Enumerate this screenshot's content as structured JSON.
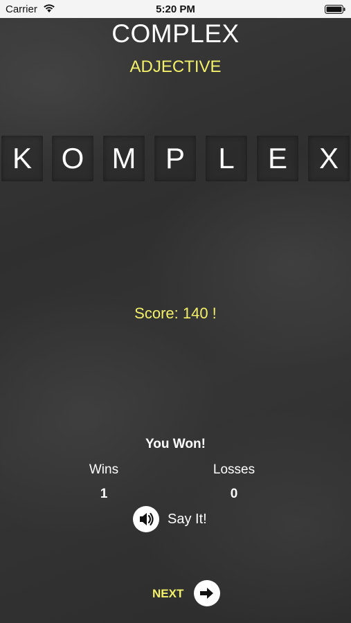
{
  "status_bar": {
    "carrier": "Carrier",
    "time": "5:20 PM"
  },
  "word": {
    "title": "COMPLEX",
    "type": "ADJECTIVE"
  },
  "letters": [
    "K",
    "O",
    "M",
    "P",
    "L",
    "E",
    "X"
  ],
  "score_text": "Score: 140 !",
  "result": {
    "message": "You Won!",
    "wins_label": "Wins",
    "losses_label": "Losses",
    "wins": "1",
    "losses": "0"
  },
  "controls": {
    "say_label": "Say It!",
    "next_label": "NEXT"
  },
  "colors": {
    "accent_yellow": "#f3f06a",
    "text": "#ffffff",
    "chalkboard": "#333333"
  },
  "icons": {
    "wifi": "wifi-icon",
    "battery": "battery-icon",
    "speaker": "speaker-icon",
    "arrow": "arrow-right-icon"
  }
}
